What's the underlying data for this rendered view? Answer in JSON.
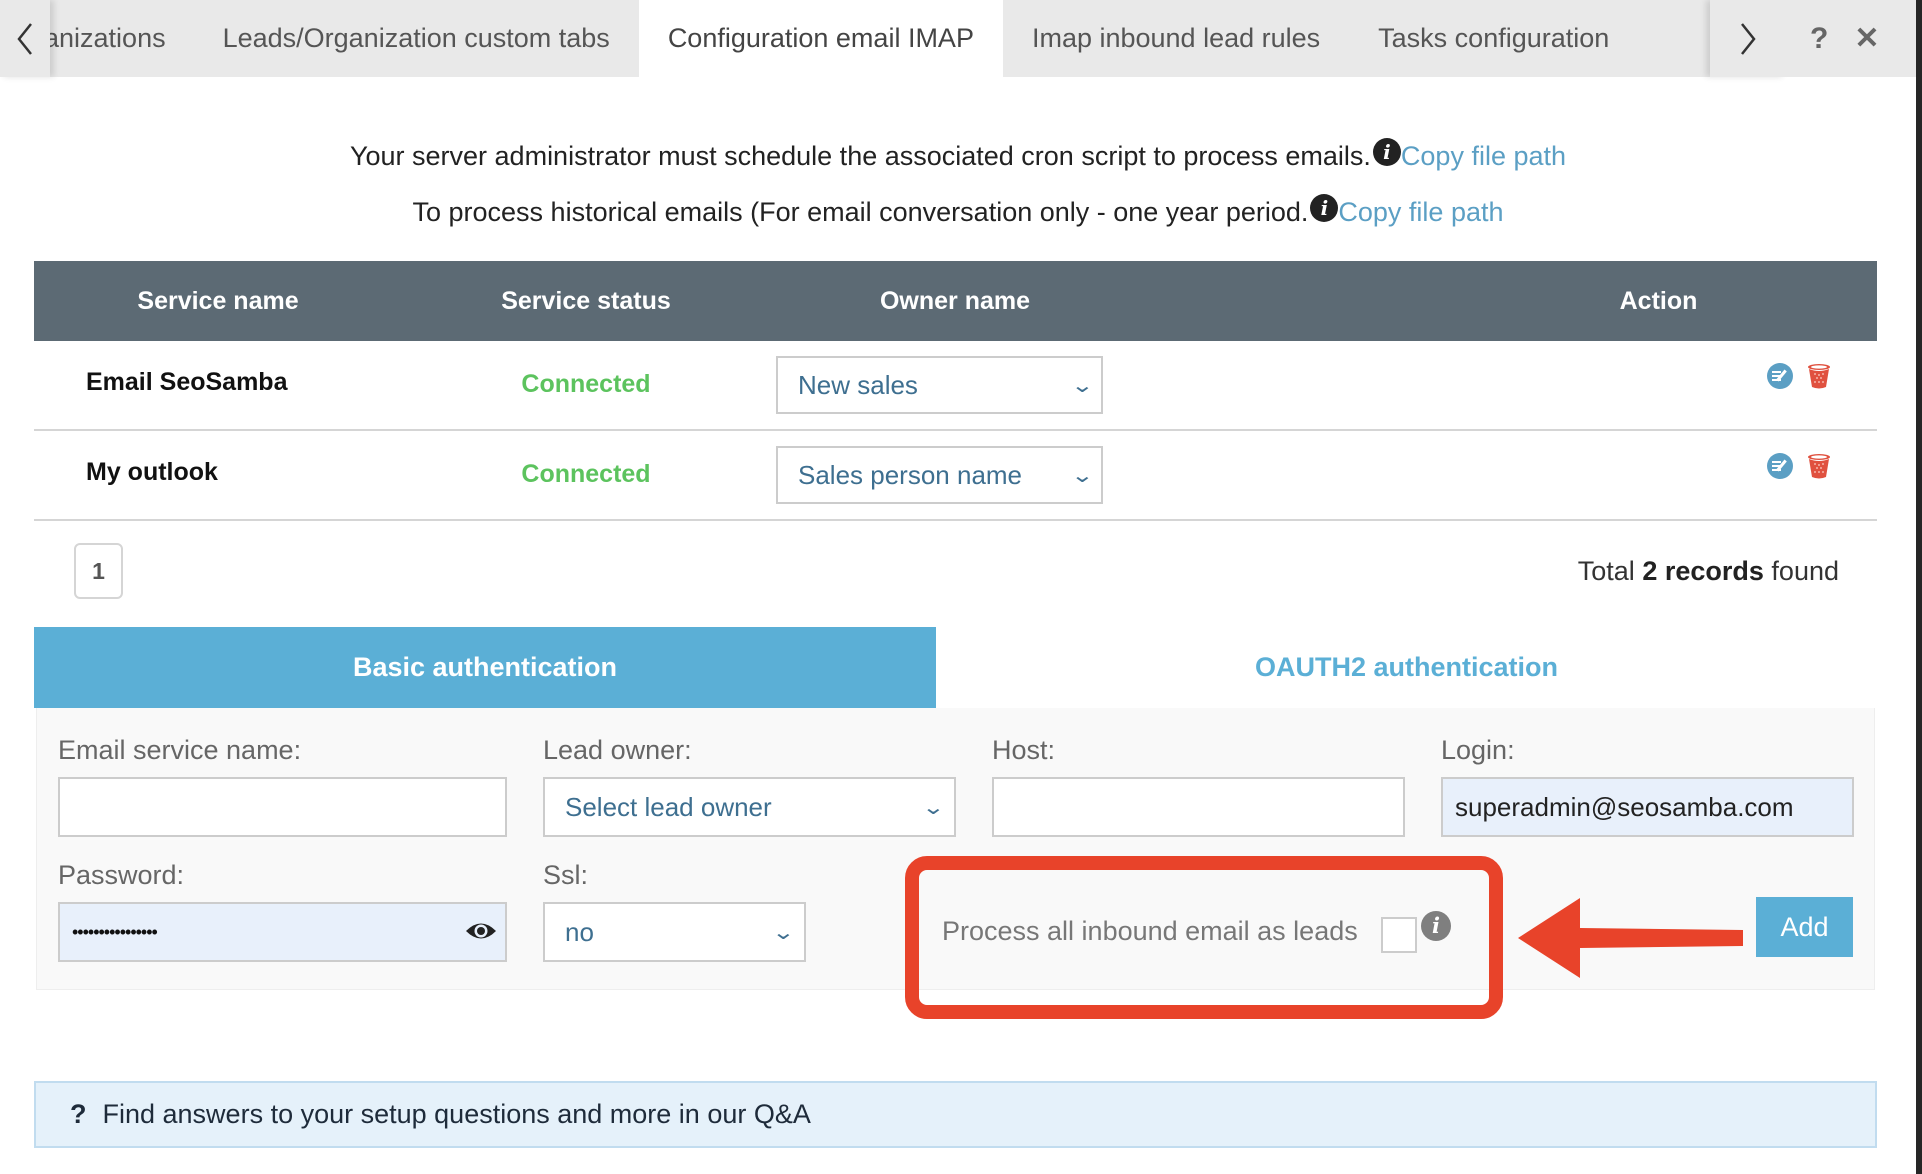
{
  "tabs": {
    "items": [
      {
        "label": "anizations",
        "active": false
      },
      {
        "label": "Leads/Organization custom tabs",
        "active": false
      },
      {
        "label": "Configuration email IMAP",
        "active": true
      },
      {
        "label": "Imap inbound lead rules",
        "active": false
      },
      {
        "label": "Tasks configuration",
        "active": false
      }
    ],
    "prev_icon": "chevron-left-icon",
    "next_icon": "chevron-right-icon",
    "help_label": "?",
    "close_label": "✕"
  },
  "info": {
    "line1_text": "Your server administrator must schedule the associated cron script to process emails.",
    "line2_text": "To process historical emails (For email conversation only - one year period.",
    "info_icon_label": "i",
    "copy_link_label": "Copy file path"
  },
  "table": {
    "columns": [
      "Service name",
      "Service status",
      "Owner name",
      "Action"
    ],
    "rows": [
      {
        "service_name": "Email SeoSamba",
        "status": "Connected",
        "owner": "New sales"
      },
      {
        "service_name": "My outlook",
        "status": "Connected",
        "owner": "Sales person name"
      }
    ],
    "status_color": "#5cc35e"
  },
  "pagination": {
    "current_page": "1",
    "total_prefix": "Total",
    "total_bold": "2 records",
    "total_suffix": "found"
  },
  "auth_tabs": {
    "basic": "Basic authentication",
    "oauth": "OAUTH2 authentication",
    "active": "basic"
  },
  "form": {
    "email_service_name_label": "Email service name:",
    "email_service_name_value": "",
    "lead_owner_label": "Lead owner:",
    "lead_owner_value": "Select lead owner",
    "host_label": "Host:",
    "host_value": "",
    "login_label": "Login:",
    "login_value": "superadmin@seosamba.com",
    "password_label": "Password:",
    "password_value": "••••••••••••••••",
    "ssl_label": "Ssl:",
    "ssl_value": "no",
    "process_all_label": "Process all inbound email as leads",
    "process_all_checked": false,
    "info_icon_label": "i",
    "add_button": "Add"
  },
  "qa": {
    "icon_label": "?",
    "text": "Find answers to your setup questions and more in our Q&A"
  },
  "colors": {
    "accent": "#5bafd6",
    "header_bg": "#5c6a74",
    "annotation_red": "#e8432a",
    "link": "#5b9fc4"
  }
}
